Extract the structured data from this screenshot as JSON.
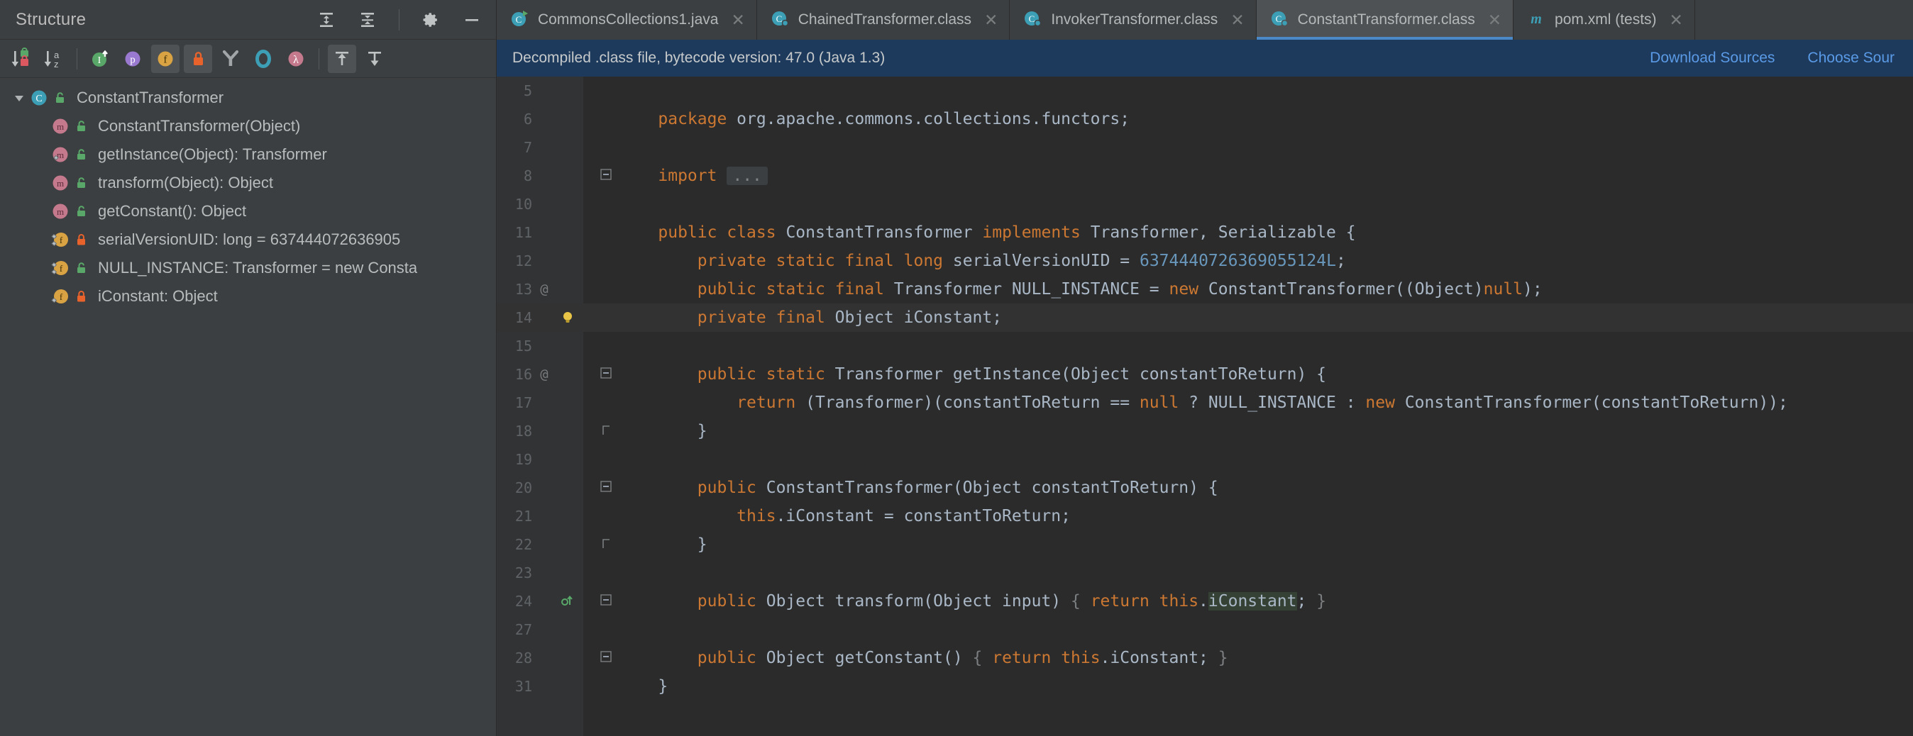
{
  "structure": {
    "title": "Structure",
    "header_icons": [
      {
        "name": "expand-all-icon",
        "glyph": "expand"
      },
      {
        "name": "collapse-all-icon",
        "glyph": "collapse"
      },
      {
        "name": "settings-gear-icon",
        "glyph": "gear"
      },
      {
        "name": "hide-icon",
        "glyph": "minus"
      }
    ],
    "toolbar_icons": [
      {
        "name": "sort-by-visibility-icon",
        "glyph": "sort-vis",
        "selected": false
      },
      {
        "name": "sort-alphabetically-icon",
        "glyph": "sort-az",
        "selected": false
      },
      {
        "name": "show-inherited-icon",
        "glyph": "inherited",
        "selected": false
      },
      {
        "name": "show-properties-icon",
        "glyph": "properties",
        "selected": false
      },
      {
        "name": "show-fields-icon",
        "glyph": "fields",
        "selected": true
      },
      {
        "name": "show-non-public-icon",
        "glyph": "nonpublic",
        "selected": true
      },
      {
        "name": "show-anonymous-classes-icon",
        "glyph": "anonymous",
        "selected": false
      },
      {
        "name": "show-interfaces-icon",
        "glyph": "interfaces",
        "selected": false
      },
      {
        "name": "show-lambdas-icon",
        "glyph": "lambdas",
        "selected": false
      },
      {
        "name": "autoscroll-to-source-icon",
        "glyph": "scroll-up",
        "selected": true
      },
      {
        "name": "autoscroll-from-source-icon",
        "glyph": "scroll-down",
        "selected": false
      }
    ],
    "tree": [
      {
        "label": "ConstantTransformer",
        "kind": "class",
        "badge": "unlock-green",
        "depth": 0,
        "expanded": true,
        "overlay": null
      },
      {
        "label": "ConstantTransformer(Object)",
        "kind": "method",
        "badge": "unlock-green",
        "depth": 1,
        "expanded": null,
        "overlay": null
      },
      {
        "label": "getInstance(Object): Transformer",
        "kind": "method",
        "badge": "unlock-green",
        "depth": 1,
        "expanded": null,
        "overlay": "static"
      },
      {
        "label": "transform(Object): Object",
        "kind": "method",
        "badge": "unlock-green",
        "depth": 1,
        "expanded": null,
        "overlay": null
      },
      {
        "label": "getConstant(): Object",
        "kind": "method",
        "badge": "unlock-green",
        "depth": 1,
        "expanded": null,
        "overlay": null
      },
      {
        "label": "serialVersionUID: long = 637444072636905",
        "kind": "field",
        "badge": "lock-red",
        "depth": 1,
        "expanded": null,
        "overlay": "static-final"
      },
      {
        "label": "NULL_INSTANCE: Transformer = new Consta",
        "kind": "field",
        "badge": "unlock-green",
        "depth": 1,
        "expanded": null,
        "overlay": "static-final"
      },
      {
        "label": "iConstant: Object",
        "kind": "field",
        "badge": "lock-red",
        "depth": 1,
        "expanded": null,
        "overlay": "final"
      }
    ]
  },
  "tabs": [
    {
      "label": "CommonsCollections1.java",
      "icon": "java-class-runnable-icon",
      "active": false,
      "closable": true
    },
    {
      "label": "ChainedTransformer.class",
      "icon": "compiled-class-icon",
      "active": false,
      "closable": true
    },
    {
      "label": "InvokerTransformer.class",
      "icon": "compiled-class-icon",
      "active": false,
      "closable": true
    },
    {
      "label": "ConstantTransformer.class",
      "icon": "compiled-class-icon",
      "active": true,
      "closable": true
    },
    {
      "label": "pom.xml (tests)",
      "icon": "maven-icon",
      "active": false,
      "closable": true
    }
  ],
  "banner": {
    "message": "Decompiled .class file, bytecode version: 47.0 (Java 1.3)",
    "links": [
      "Download Sources",
      "Choose Sour"
    ],
    "background": "#1d3a5c",
    "link_color": "#5a9ae6"
  },
  "editor": {
    "lines": [
      {
        "num": "5",
        "anno": "",
        "fold": null,
        "gutter_icon": null,
        "highlight": false,
        "tokens": []
      },
      {
        "num": "6",
        "anno": "",
        "fold": null,
        "gutter_icon": null,
        "highlight": false,
        "tokens": [
          {
            "t": "    ",
            "c": "plain"
          },
          {
            "t": "package",
            "c": "kw"
          },
          {
            "t": " org.apache.commons.collections.functors;",
            "c": "plain"
          }
        ]
      },
      {
        "num": "7",
        "anno": "",
        "fold": null,
        "gutter_icon": null,
        "highlight": false,
        "tokens": []
      },
      {
        "num": "8",
        "anno": "",
        "fold": "minus",
        "gutter_icon": null,
        "highlight": false,
        "tokens": [
          {
            "t": "    ",
            "c": "plain"
          },
          {
            "t": "import",
            "c": "kw"
          },
          {
            "t": " ",
            "c": "plain"
          },
          {
            "t": "...",
            "c": "dots"
          }
        ]
      },
      {
        "num": "10",
        "anno": "",
        "fold": null,
        "gutter_icon": null,
        "highlight": false,
        "tokens": []
      },
      {
        "num": "11",
        "anno": "",
        "fold": null,
        "gutter_icon": null,
        "highlight": false,
        "tokens": [
          {
            "t": "    ",
            "c": "plain"
          },
          {
            "t": "public",
            "c": "kw"
          },
          {
            "t": " ",
            "c": "plain"
          },
          {
            "t": "class",
            "c": "kw"
          },
          {
            "t": " ConstantTransformer ",
            "c": "plain"
          },
          {
            "t": "implements",
            "c": "kw"
          },
          {
            "t": " Transformer, Serializable {",
            "c": "plain"
          }
        ]
      },
      {
        "num": "12",
        "anno": "",
        "fold": null,
        "gutter_icon": null,
        "highlight": false,
        "tokens": [
          {
            "t": "        ",
            "c": "plain"
          },
          {
            "t": "private",
            "c": "kw"
          },
          {
            "t": " ",
            "c": "plain"
          },
          {
            "t": "static",
            "c": "kw"
          },
          {
            "t": " ",
            "c": "plain"
          },
          {
            "t": "final",
            "c": "kw"
          },
          {
            "t": " ",
            "c": "plain"
          },
          {
            "t": "long",
            "c": "kw"
          },
          {
            "t": " serialVersionUID = ",
            "c": "plain"
          },
          {
            "t": "6374440726369055124L",
            "c": "num"
          },
          {
            "t": ";",
            "c": "plain"
          }
        ]
      },
      {
        "num": "13",
        "anno": "@",
        "fold": null,
        "gutter_icon": null,
        "highlight": false,
        "tokens": [
          {
            "t": "        ",
            "c": "plain"
          },
          {
            "t": "public",
            "c": "kw"
          },
          {
            "t": " ",
            "c": "plain"
          },
          {
            "t": "static",
            "c": "kw"
          },
          {
            "t": " ",
            "c": "plain"
          },
          {
            "t": "final",
            "c": "kw"
          },
          {
            "t": " Transformer NULL_INSTANCE = ",
            "c": "plain"
          },
          {
            "t": "new",
            "c": "kw"
          },
          {
            "t": " ConstantTransformer((Object)",
            "c": "plain"
          },
          {
            "t": "null",
            "c": "kw"
          },
          {
            "t": ");",
            "c": "plain"
          }
        ]
      },
      {
        "num": "14",
        "anno": "",
        "fold": null,
        "gutter_icon": "bulb",
        "highlight": true,
        "tokens": [
          {
            "t": "        ",
            "c": "plain"
          },
          {
            "t": "private",
            "c": "kw"
          },
          {
            "t": " ",
            "c": "plain"
          },
          {
            "t": "final",
            "c": "kw"
          },
          {
            "t": " Object iConstant;",
            "c": "plain"
          }
        ]
      },
      {
        "num": "15",
        "anno": "",
        "fold": null,
        "gutter_icon": null,
        "highlight": false,
        "tokens": []
      },
      {
        "num": "16",
        "anno": "@",
        "fold": "minus",
        "gutter_icon": null,
        "highlight": false,
        "tokens": [
          {
            "t": "        ",
            "c": "plain"
          },
          {
            "t": "public",
            "c": "kw"
          },
          {
            "t": " ",
            "c": "plain"
          },
          {
            "t": "static",
            "c": "kw"
          },
          {
            "t": " Transformer getInstance(Object constantToReturn) {",
            "c": "plain"
          }
        ]
      },
      {
        "num": "17",
        "anno": "",
        "fold": null,
        "gutter_icon": null,
        "highlight": false,
        "tokens": [
          {
            "t": "            ",
            "c": "plain"
          },
          {
            "t": "return",
            "c": "kw"
          },
          {
            "t": " (Transformer)(constantToReturn == ",
            "c": "plain"
          },
          {
            "t": "null",
            "c": "kw"
          },
          {
            "t": " ? NULL_INSTANCE : ",
            "c": "plain"
          },
          {
            "t": "new",
            "c": "kw"
          },
          {
            "t": " ConstantTransformer(constantToReturn));",
            "c": "plain"
          }
        ]
      },
      {
        "num": "18",
        "anno": "",
        "fold": "end",
        "gutter_icon": null,
        "highlight": false,
        "tokens": [
          {
            "t": "        }",
            "c": "plain"
          }
        ]
      },
      {
        "num": "19",
        "anno": "",
        "fold": null,
        "gutter_icon": null,
        "highlight": false,
        "tokens": []
      },
      {
        "num": "20",
        "anno": "",
        "fold": "minus",
        "gutter_icon": null,
        "highlight": false,
        "tokens": [
          {
            "t": "        ",
            "c": "plain"
          },
          {
            "t": "public",
            "c": "kw"
          },
          {
            "t": " ConstantTransformer(Object constantToReturn) {",
            "c": "plain"
          }
        ]
      },
      {
        "num": "21",
        "anno": "",
        "fold": null,
        "gutter_icon": null,
        "highlight": false,
        "tokens": [
          {
            "t": "            ",
            "c": "plain"
          },
          {
            "t": "this",
            "c": "kw"
          },
          {
            "t": ".iConstant = constantToReturn;",
            "c": "plain"
          }
        ]
      },
      {
        "num": "22",
        "anno": "",
        "fold": "end",
        "gutter_icon": null,
        "highlight": false,
        "tokens": [
          {
            "t": "        }",
            "c": "plain"
          }
        ]
      },
      {
        "num": "23",
        "anno": "",
        "fold": null,
        "gutter_icon": null,
        "highlight": false,
        "tokens": []
      },
      {
        "num": "24",
        "anno": "",
        "fold": "minus",
        "gutter_icon": "override",
        "highlight": false,
        "tokens": [
          {
            "t": "        ",
            "c": "plain"
          },
          {
            "t": "public",
            "c": "kw"
          },
          {
            "t": " Object transform(Object input) ",
            "c": "plain"
          },
          {
            "t": "{",
            "c": "fold"
          },
          {
            "t": " ",
            "c": "plain"
          },
          {
            "t": "return",
            "c": "kw"
          },
          {
            "t": " ",
            "c": "plain"
          },
          {
            "t": "this",
            "c": "kw"
          },
          {
            "t": ".",
            "c": "plain"
          },
          {
            "t": "iConstant",
            "c": "ident-hl"
          },
          {
            "t": "; ",
            "c": "plain"
          },
          {
            "t": "}",
            "c": "fold"
          }
        ]
      },
      {
        "num": "27",
        "anno": "",
        "fold": null,
        "gutter_icon": null,
        "highlight": false,
        "tokens": []
      },
      {
        "num": "28",
        "anno": "",
        "fold": "minus",
        "gutter_icon": null,
        "highlight": false,
        "tokens": [
          {
            "t": "        ",
            "c": "plain"
          },
          {
            "t": "public",
            "c": "kw"
          },
          {
            "t": " Object getConstant() ",
            "c": "plain"
          },
          {
            "t": "{",
            "c": "fold"
          },
          {
            "t": " ",
            "c": "plain"
          },
          {
            "t": "return",
            "c": "kw"
          },
          {
            "t": " ",
            "c": "plain"
          },
          {
            "t": "this",
            "c": "kw"
          },
          {
            "t": ".iConstant; ",
            "c": "plain"
          },
          {
            "t": "}",
            "c": "fold"
          }
        ]
      },
      {
        "num": "31",
        "anno": "",
        "fold": null,
        "gutter_icon": null,
        "highlight": false,
        "tokens": [
          {
            "t": "    }",
            "c": "plain"
          }
        ]
      }
    ]
  },
  "colors": {
    "keyword": "#cc7832",
    "number": "#6897bb",
    "identifier": "#a9b7c6",
    "editor_bg": "#2b2b2b",
    "gutter_bg": "#313335",
    "panel_bg": "#3c3f41",
    "tab_active_bg": "#4e5254",
    "tab_underline": "#4a88c7"
  }
}
